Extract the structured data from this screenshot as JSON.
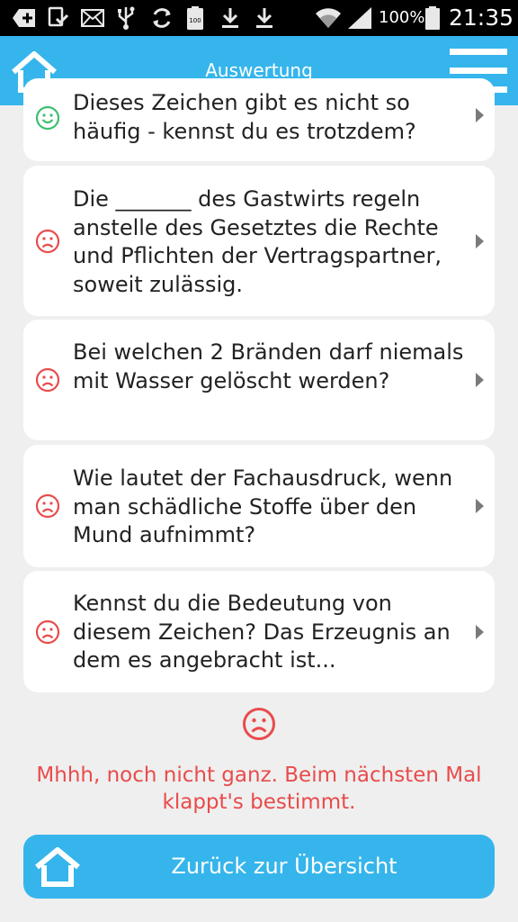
{
  "status_bar": {
    "icons": [
      "add-icon",
      "download-check-icon",
      "mail-icon",
      "usb-icon",
      "sync-icon",
      "battery-full-icon",
      "download-icon",
      "download-icon",
      "wifi-icon",
      "signal-icon",
      "battery-icon"
    ],
    "battery_small_label": "100",
    "battery": "100%",
    "time": "21:35"
  },
  "header": {
    "title": "Auswertung",
    "home_icon": "home-icon",
    "menu_icon": "hamburger-menu-icon"
  },
  "questions": [
    {
      "text": "Dieses Zeichen gibt es nicht so häufig - kennst du es trotzdem?",
      "status": "correct",
      "status_icon": "smiley-happy-icon"
    },
    {
      "text": "Die _______  des Gastwirts regeln anstelle des Gesetztes die Rechte und Pflichten der Vertragspartner, soweit zulässig.",
      "status": "wrong",
      "status_icon": "smiley-sad-icon"
    },
    {
      "text": "Bei welchen 2 Bränden darf niemals mit Wasser gelöscht werden?",
      "status": "wrong",
      "status_icon": "smiley-sad-icon"
    },
    {
      "text": "Wie lautet der Fachausdruck, wenn man schädliche Stoffe über den Mund aufnimmt?",
      "status": "wrong",
      "status_icon": "smiley-sad-icon"
    },
    {
      "text": "Kennst du die Bedeutung von diesem Zeichen? Das Erzeugnis an dem es angebracht ist...",
      "status": "wrong",
      "status_icon": "smiley-sad-icon"
    }
  ],
  "result": {
    "icon": "smiley-sad-icon",
    "message": "Mhhh, noch nicht ganz. Beim nächsten Mal klappt's bestimmt."
  },
  "back_button": {
    "label": "Zurück zur Übersicht",
    "icon": "home-icon"
  },
  "colors": {
    "accent": "#35b5eb",
    "correct": "#3dbf6e",
    "wrong": "#e94b4b",
    "background": "#efefef"
  }
}
